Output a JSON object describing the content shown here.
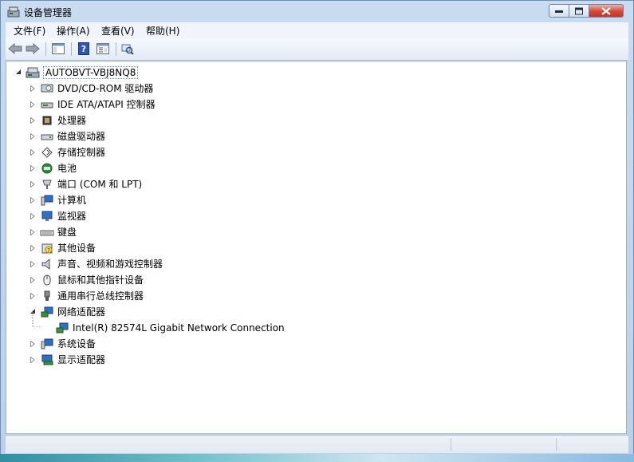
{
  "window": {
    "title": "设备管理器"
  },
  "menu": [
    "文件(F)",
    "操作(A)",
    "查看(V)",
    "帮助(H)"
  ],
  "tree": {
    "root": "AUTOBVT-VBJ8NQ8",
    "items": [
      {
        "label": "DVD/CD-ROM 驱动器",
        "icon": "dvd-drive-icon",
        "expanded": false
      },
      {
        "label": "IDE ATA/ATAPI 控制器",
        "icon": "ide-controller-icon",
        "expanded": false
      },
      {
        "label": "处理器",
        "icon": "processor-icon",
        "expanded": false
      },
      {
        "label": "磁盘驱动器",
        "icon": "disk-drive-icon",
        "expanded": false
      },
      {
        "label": "存储控制器",
        "icon": "storage-controller-icon",
        "expanded": false
      },
      {
        "label": "电池",
        "icon": "battery-icon",
        "expanded": false
      },
      {
        "label": "端口 (COM 和 LPT)",
        "icon": "port-icon",
        "expanded": false
      },
      {
        "label": "计算机",
        "icon": "computer-icon",
        "expanded": false
      },
      {
        "label": "监视器",
        "icon": "monitor-icon",
        "expanded": false
      },
      {
        "label": "键盘",
        "icon": "keyboard-icon",
        "expanded": false
      },
      {
        "label": "其他设备",
        "icon": "unknown-device-icon",
        "expanded": false
      },
      {
        "label": "声音、视频和游戏控制器",
        "icon": "sound-icon",
        "expanded": false
      },
      {
        "label": "鼠标和其他指针设备",
        "icon": "mouse-icon",
        "expanded": false
      },
      {
        "label": "通用串行总线控制器",
        "icon": "usb-icon",
        "expanded": false
      },
      {
        "label": "网络适配器",
        "icon": "network-adapter-icon",
        "expanded": true
      },
      {
        "label": "Intel(R) 82574L Gigabit Network Connection",
        "icon": "network-card-icon",
        "child": true
      },
      {
        "label": "系统设备",
        "icon": "system-device-icon",
        "expanded": false
      },
      {
        "label": "显示适配器",
        "icon": "display-adapter-icon",
        "expanded": false
      }
    ]
  }
}
